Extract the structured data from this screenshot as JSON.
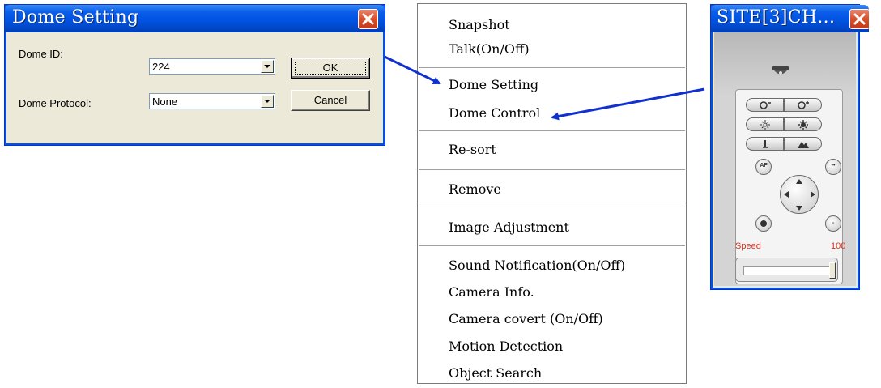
{
  "dome_dialog": {
    "title": "Dome Setting",
    "dome_id_label": "Dome ID:",
    "dome_id_value": "224",
    "dome_protocol_label": "Dome Protocol:",
    "dome_protocol_value": "None",
    "ok_label": "OK",
    "cancel_label": "Cancel"
  },
  "context_menu": {
    "groups": [
      [
        "Snapshot",
        "Talk(On/Off)"
      ],
      [
        "Dome Setting",
        "Dome Control"
      ],
      [
        "Re-sort"
      ],
      [
        "Remove"
      ],
      [
        "Image Adjustment"
      ],
      [
        "Sound Notification(On/Off)",
        "Camera Info.",
        "Camera covert (On/Off)",
        "Motion Detection",
        "Object Search"
      ]
    ]
  },
  "ptz_window": {
    "title": "SITE[3]CH...",
    "speed_label": "Speed",
    "speed_value": "100",
    "speed_level": 1.0,
    "ctrl_af": "AF",
    "ctrl_oo": "••"
  },
  "colors": {
    "titlebar": "#0054e3",
    "arrow": "#1030d0",
    "close_button": "#d84f2a",
    "speed_text": "#e03020"
  }
}
